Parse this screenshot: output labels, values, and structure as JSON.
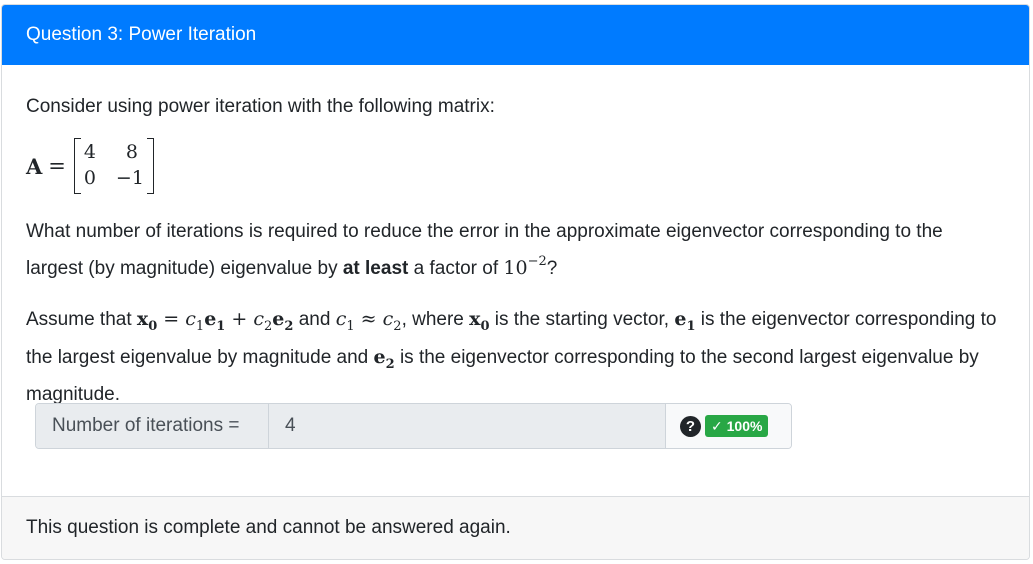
{
  "header": {
    "title": "Question 3: Power Iteration"
  },
  "body": {
    "intro": "Consider using power iteration with the following matrix:",
    "matrix": {
      "name": "A",
      "rows": [
        [
          "4",
          "8"
        ],
        [
          "0",
          "−1"
        ]
      ]
    },
    "question": {
      "part1": "What number of iterations is required to reduce the error in the approximate eigenvector corresponding to the largest (by magnitude) eigenvalue by ",
      "bold": "at least",
      "part2": " a factor of ",
      "factor_base": "10",
      "factor_exp": "−2",
      "part3": "?"
    },
    "assumption": {
      "t1": "Assume that ",
      "x0": "x",
      "x0_sub": "0",
      "eq1": " = ",
      "c1": "c",
      "c1_sub": "1",
      "e1": "e",
      "e1_sub": "1",
      "plus": " + ",
      "c2": "c",
      "c2_sub": "2",
      "e2": "e",
      "e2_sub": "2",
      "t2": " and ",
      "approx": " ≈ ",
      "t3": ", where ",
      "t4": " is the starting vector, ",
      "t5": " is the eigenvector corresponding to the largest eigenvalue by magnitude and ",
      "t6": " is the eigenvector corresponding to the second largest eigenvalue by magnitude."
    }
  },
  "answer": {
    "label": "Number of iterations =",
    "value": "4",
    "help_icon": "question-circle-icon",
    "badge": "✓ 100%"
  },
  "footer": {
    "text": "This question is complete and cannot be answered again."
  },
  "colors": {
    "header_bg": "#007bff",
    "badge_bg": "#28a745"
  }
}
